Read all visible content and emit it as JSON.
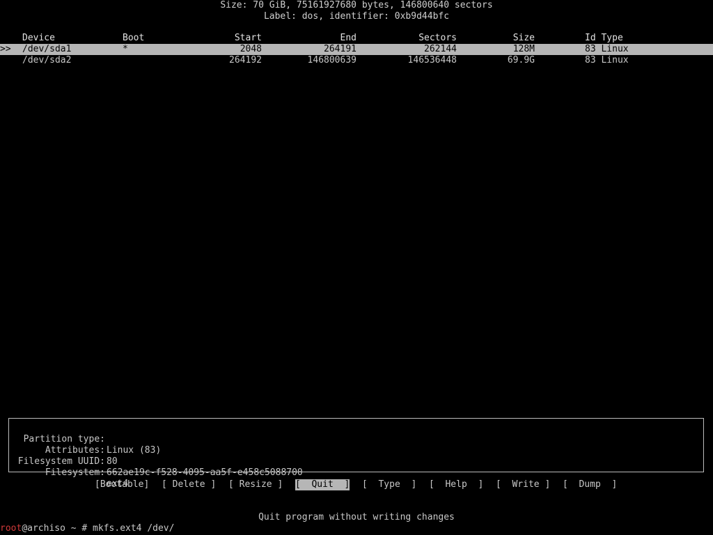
{
  "header": {
    "size_line": "Size: 70 GiB, 75161927680 bytes, 146800640 sectors",
    "label_line": "Label: dos, identifier: 0xb9d44bfc"
  },
  "table": {
    "columns": {
      "device": "Device",
      "boot": "Boot",
      "start": "Start",
      "end": "End",
      "sectors": "Sectors",
      "size": "Size",
      "id_type": "Id Type"
    },
    "selection_marker": ">>",
    "rows": [
      {
        "device": "/dev/sda1",
        "boot": "*",
        "start": "2048",
        "end": "264191",
        "sectors": "262144",
        "size": "128M",
        "id_type": "83 Linux",
        "selected": true
      },
      {
        "device": "/dev/sda2",
        "boot": "",
        "start": "264192",
        "end": "146800639",
        "sectors": "146536448",
        "size": "69.9G",
        "id_type": "83 Linux",
        "selected": false
      }
    ]
  },
  "info": {
    "partition_type_label": "Partition type:",
    "partition_type_value": "Linux (83)",
    "attributes_label": "Attributes:",
    "attributes_value": "80",
    "uuid_label": "Filesystem UUID:",
    "uuid_value": "662ae19c-f528-4095-aa5f-e458c5088700",
    "filesystem_label": "Filesystem:",
    "filesystem_value": "ext4"
  },
  "menu": {
    "bootable": "[Bootable]",
    "delete": "[ Delete ]",
    "resize": "[ Resize ]",
    "quit": "[  Quit  ]",
    "type": "[  Type  ]",
    "help": "[  Help  ]",
    "write": "[  Write ]",
    "dump": "[  Dump  ]",
    "active": "quit"
  },
  "status": {
    "hint": "Quit program without writing changes"
  },
  "prompt": {
    "user": "root",
    "rest": "@archiso ~ # mkfs.ext4 /dev/"
  },
  "colors": {
    "background": "#000000",
    "text": "#c8c8c8",
    "highlight_bg": "#b6b6b6",
    "highlight_fg": "#000000",
    "prompt_user": "#d23a3a"
  }
}
